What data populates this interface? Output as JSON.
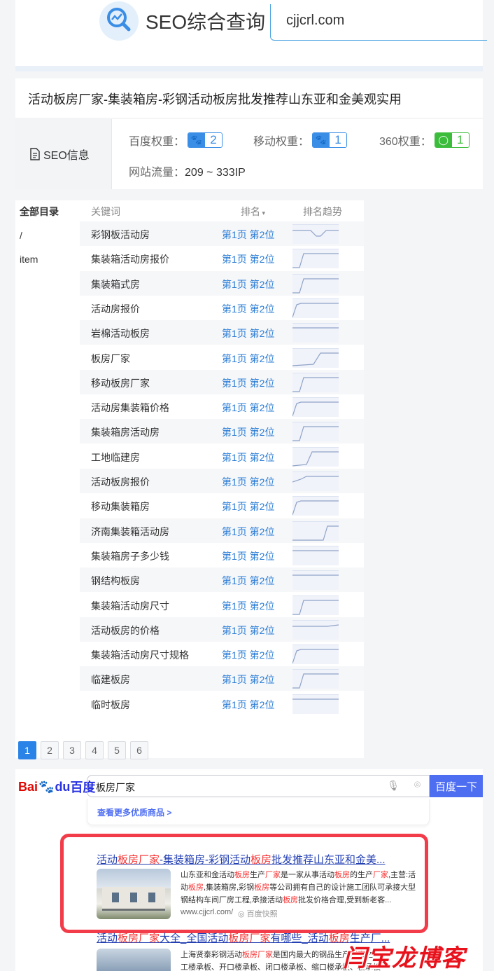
{
  "header": {
    "logo_icon": "chart-search-icon",
    "title": "SEO综合查询",
    "domain": "cjjcrl.com"
  },
  "site": {
    "title": "活动板房厂家-集装箱房-彩钢活动板房批发推荐山东亚和金美观实用"
  },
  "seo_info": {
    "label": "SEO信息",
    "label_icon": "document-icon",
    "baidu_weight_label": "百度权重：",
    "baidu_weight": "2",
    "mobile_weight_label": "移动权重：",
    "mobile_weight": "1",
    "weight360_label": "360权重：",
    "weight360": "1",
    "traffic_label": "网站流量：",
    "traffic_value": "209 ~ 333IP",
    "colors": {
      "baidu": "#3a8ee6",
      "so360": "#3bbd3b"
    }
  },
  "directory": {
    "header": "全部目录",
    "items": [
      "/",
      "item"
    ]
  },
  "keyword_table": {
    "headers": {
      "keyword": "关键词",
      "rank": "排名",
      "trend": "排名趋势"
    },
    "rows": [
      {
        "keyword": "彩钢板活动房",
        "rank": "第1页 第2位",
        "trend": "dip"
      },
      {
        "keyword": "集装箱活动房报价",
        "rank": "第1页 第2位",
        "trend": "rise-early"
      },
      {
        "keyword": "集装箱式房",
        "rank": "第1页 第2位",
        "trend": "rise-early"
      },
      {
        "keyword": "活动房报价",
        "rank": "第1页 第2位",
        "trend": "rise-start"
      },
      {
        "keyword": "岩棉活动板房",
        "rank": "第1页 第2位",
        "trend": "flat"
      },
      {
        "keyword": "板房厂家",
        "rank": "第1页 第2位",
        "trend": "rise-late"
      },
      {
        "keyword": "移动板房厂家",
        "rank": "第1页 第2位",
        "trend": "rise-early"
      },
      {
        "keyword": "活动房集装箱价格",
        "rank": "第1页 第2位",
        "trend": "rise-start"
      },
      {
        "keyword": "集装箱房活动房",
        "rank": "第1页 第2位",
        "trend": "rise-early"
      },
      {
        "keyword": "工地临建房",
        "rank": "第1页 第2位",
        "trend": "rise-mid"
      },
      {
        "keyword": "活动板房报价",
        "rank": "第1页 第2位",
        "trend": "rise-soft"
      },
      {
        "keyword": "移动集装箱房",
        "rank": "第1页 第2位",
        "trend": "rise-start"
      },
      {
        "keyword": "济南集装箱活动房",
        "rank": "第1页 第2位",
        "trend": "rise-end"
      },
      {
        "keyword": "集装箱房子多少钱",
        "rank": "第1页 第2位",
        "trend": "flat"
      },
      {
        "keyword": "钢结构板房",
        "rank": "第1页 第2位",
        "trend": "flat"
      },
      {
        "keyword": "集装箱活动房尺寸",
        "rank": "第1页 第2位",
        "trend": "rise-early"
      },
      {
        "keyword": "活动板房的价格",
        "rank": "第1页 第2位",
        "trend": "slight"
      },
      {
        "keyword": "集装箱活动房尺寸规格",
        "rank": "第1页 第2位",
        "trend": "rise-start"
      },
      {
        "keyword": "临建板房",
        "rank": "第1页 第2位",
        "trend": "rise-early"
      },
      {
        "keyword": "临时板房",
        "rank": "第1页 第2位",
        "trend": "flat"
      }
    ]
  },
  "pagination": {
    "pages": [
      "1",
      "2",
      "3",
      "4",
      "5",
      "6"
    ],
    "active": "1"
  },
  "baidu": {
    "logo_bai": "Bai",
    "logo_du": "du",
    "logo_cn": "百度",
    "query": "板房厂家",
    "search_button": "百度一下",
    "more_link": "查看更多优质商品 >",
    "result1": {
      "title_a": "活动",
      "title_b": "板房厂家",
      "title_c": "-集装箱房-彩钢活动",
      "title_d": "板房",
      "title_e": "批发推荐山东亚和金美...",
      "snippet_a": "山东亚和金活动",
      "snippet_b": "板房",
      "snippet_c": "生产",
      "snippet_d": "厂家",
      "snippet_e": "是一家从事活动",
      "snippet_f": "板房",
      "snippet_g": "的生产",
      "snippet_h": "厂家",
      "snippet_i": ",主营:活动",
      "snippet_j": "板房",
      "snippet_k": ",集装箱房,彩钢",
      "snippet_l": "板房",
      "snippet_m": "等公司拥有自己的设计施工团队可承接大型钢结构车间厂房工程,承接活动",
      "snippet_n": "板房",
      "snippet_o": "批发价格合理,受到新老客...",
      "url": "www.cjjcrl.com/",
      "snapshot": "百度快照"
    },
    "result2": {
      "title_a": "活动",
      "title_b": "板房厂家",
      "title_c": "大全_全国活动",
      "title_d": "板房厂家",
      "title_e": "有哪些_活动",
      "title_f": "板房",
      "title_g": "生产厂...",
      "snippet_a": "上海贤泰彩钢活动",
      "snippet_b": "板房厂家",
      "snippet_c": "是国内最大的钢品生产",
      "snippet_d": "厂家",
      "snippet_e": "之一,",
      "snippet_f": "工楼承板、开口楼承板、闭口楼承板、缩口楼承板、楼承板"
    }
  },
  "watermark": "闫宝龙博客"
}
